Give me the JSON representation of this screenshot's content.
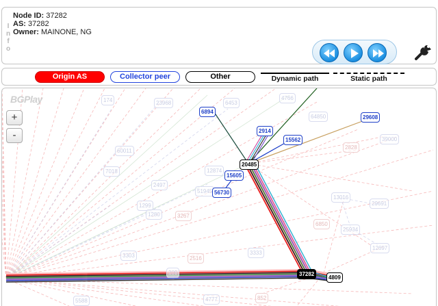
{
  "info": {
    "vertical_label": "Info",
    "node_id_label": "Node ID:",
    "node_id_value": "37282",
    "as_label": "AS:",
    "as_value": "37282",
    "owner_label": "Owner:",
    "owner_value": "MAINONE, NG"
  },
  "controls": {
    "rewind_icon": "rewind-icon",
    "play_icon": "play-icon",
    "forward_icon": "fast-forward-icon",
    "settings_icon": "wrench-icon",
    "zoom_in": "+",
    "zoom_out": "-"
  },
  "legend": {
    "origin_as": "Origin AS",
    "collector_peer": "Collector peer",
    "other": "Other",
    "dynamic_path": "Dynamic path",
    "static_path": "Static path"
  },
  "graph": {
    "logo": "BGPlay",
    "nodes": {
      "n6894": "6894",
      "n2914": "2914",
      "n15562": "15562",
      "n29608": "29608",
      "n20485": "20485",
      "n15605": "15605",
      "n56730": "56730",
      "n37282": "37282",
      "n4809": "4809",
      "f1": "12874",
      "f2": "6453",
      "f3": "4766",
      "f4": "64850",
      "f5": "2828",
      "f6": "39000",
      "f7": "2497",
      "f8": "51945",
      "f9": "1299",
      "f10": "3267",
      "f11": "6850",
      "f12": "13016",
      "f13": "25934",
      "f14": "12697",
      "f15": "3333",
      "f16": "2516",
      "f17": "3303",
      "f18": "7018",
      "f19": "1280",
      "f20": "852",
      "f21": "4777",
      "f22": "5588",
      "f23": "29691",
      "f24": "209",
      "f25": "60011",
      "f26": "23968",
      "f27": "174"
    }
  },
  "colors": {
    "origin": "#ff0000",
    "collector": "#1d3fc8",
    "accent_blue": "#1b8fe0"
  }
}
